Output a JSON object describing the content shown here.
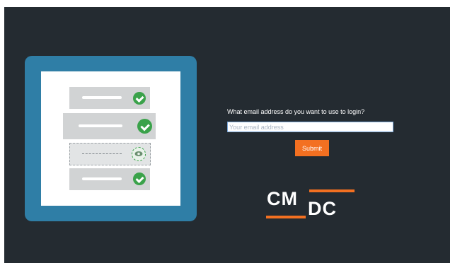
{
  "login": {
    "prompt": "What email address do you want to use to login?",
    "email_placeholder": "Your email address",
    "email_value": "",
    "submit_label": "Submit"
  },
  "logo": {
    "text_top": "CM",
    "text_bottom": "DC"
  },
  "colors": {
    "background": "#242b31",
    "illustration_frame": "#2f7ea6",
    "accent": "#f37021",
    "check": "#3aa24a"
  },
  "icons": [
    "check-icon",
    "eye-icon"
  ]
}
